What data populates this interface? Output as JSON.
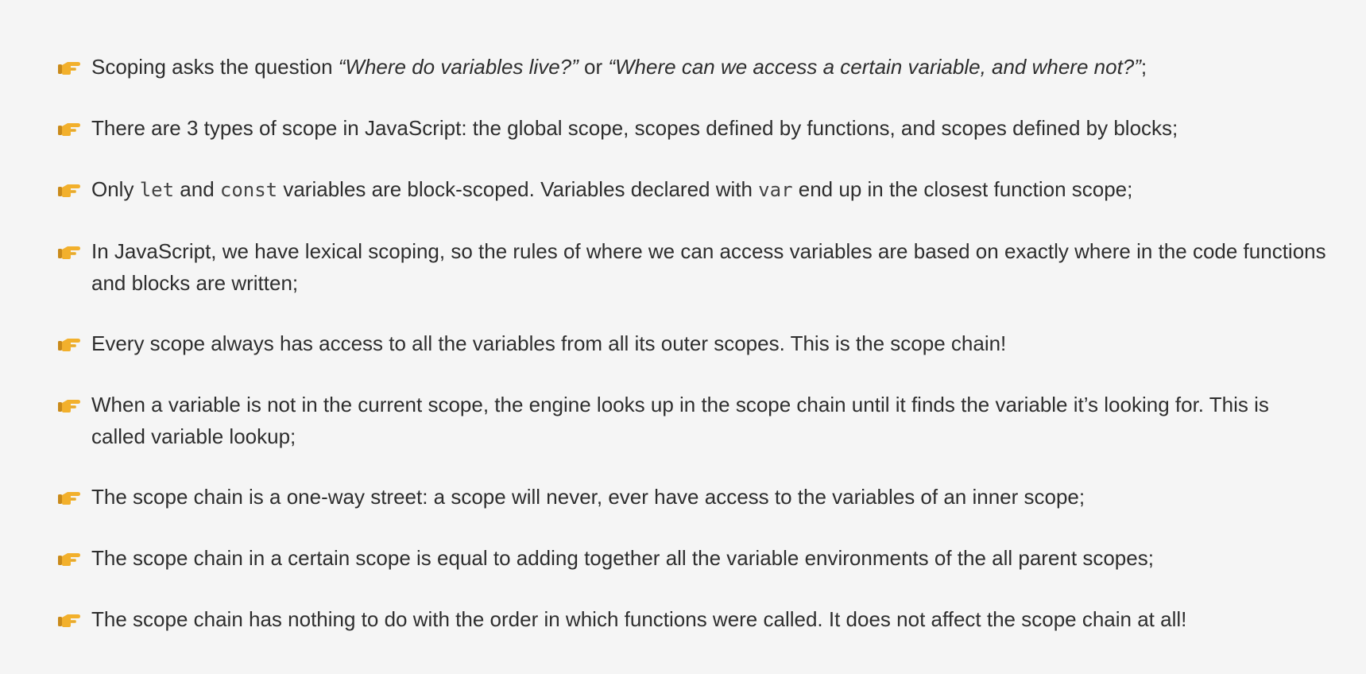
{
  "bullet_icon": "pointing-hand-icon",
  "colors": {
    "background": "#f5f5f5",
    "text": "#2e2e2e",
    "icon": "#f2b02c"
  },
  "items": [
    {
      "t1": "Scoping asks the question ",
      "q1": "“Where do variables live?”",
      "t2": " or ",
      "q2": "“Where can we access a certain variable, and where not?”",
      "t3": ";"
    },
    {
      "text": "There are 3 types of scope in JavaScript: the global scope, scopes defined by functions, and scopes defined by blocks;"
    },
    {
      "t1": "Only ",
      "c1": "let",
      "t2": " and ",
      "c2": "const",
      "t3": " variables are block-scoped. Variables declared with ",
      "c3": "var",
      "t4": " end up in the closest function scope;"
    },
    {
      "text": "In JavaScript, we have lexical scoping, so the rules of where we can access variables are based on exactly where in the code functions and blocks are written;"
    },
    {
      "text": "Every scope always has access to all the variables from all its outer scopes. This is the scope chain!"
    },
    {
      "text": "When a variable is not in the current scope, the engine looks up in the scope chain until it finds the variable it’s looking for. This is called variable lookup;"
    },
    {
      "text": "The scope chain is a one-way street: a scope will never, ever have access to the variables of an inner scope;"
    },
    {
      "text": "The scope chain in a certain scope is equal to adding together all the variable environments of the all parent scopes;"
    },
    {
      "text": "The scope chain has nothing to do with the order in which functions were called. It does not affect the scope chain at all!"
    }
  ]
}
